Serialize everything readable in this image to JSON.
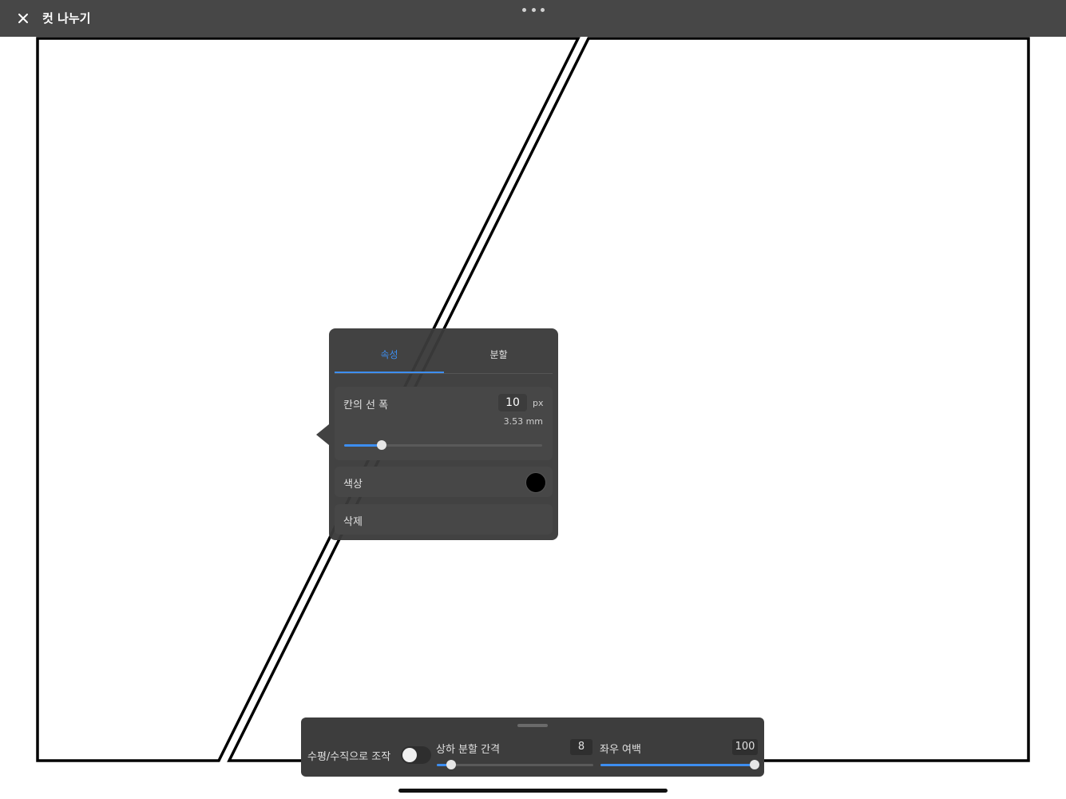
{
  "header": {
    "close_icon": "close-icon",
    "title": "컷 나누기",
    "more_icon": "more-dots-icon"
  },
  "popover": {
    "tabs": [
      {
        "label": "속성",
        "active": true
      },
      {
        "label": "분할",
        "active": false
      }
    ],
    "line_width": {
      "label": "칸의 선 폭",
      "value": "10",
      "unit": "px",
      "mm_text": "3.53 mm",
      "slider_fraction": 0.19
    },
    "color": {
      "label": "색상",
      "value": "#000000"
    },
    "delete_label": "삭제",
    "accent": "#3d8ef0"
  },
  "toolbar": {
    "toggle_label": "수평/수직으로 조작",
    "toggle_on": false,
    "vertical_gap": {
      "label": "상하 분할 간격",
      "value": "8",
      "slider_fraction": 0.09
    },
    "horizontal_margin": {
      "label": "좌우 여백",
      "value": "100",
      "slider_fraction": 1.0
    }
  }
}
